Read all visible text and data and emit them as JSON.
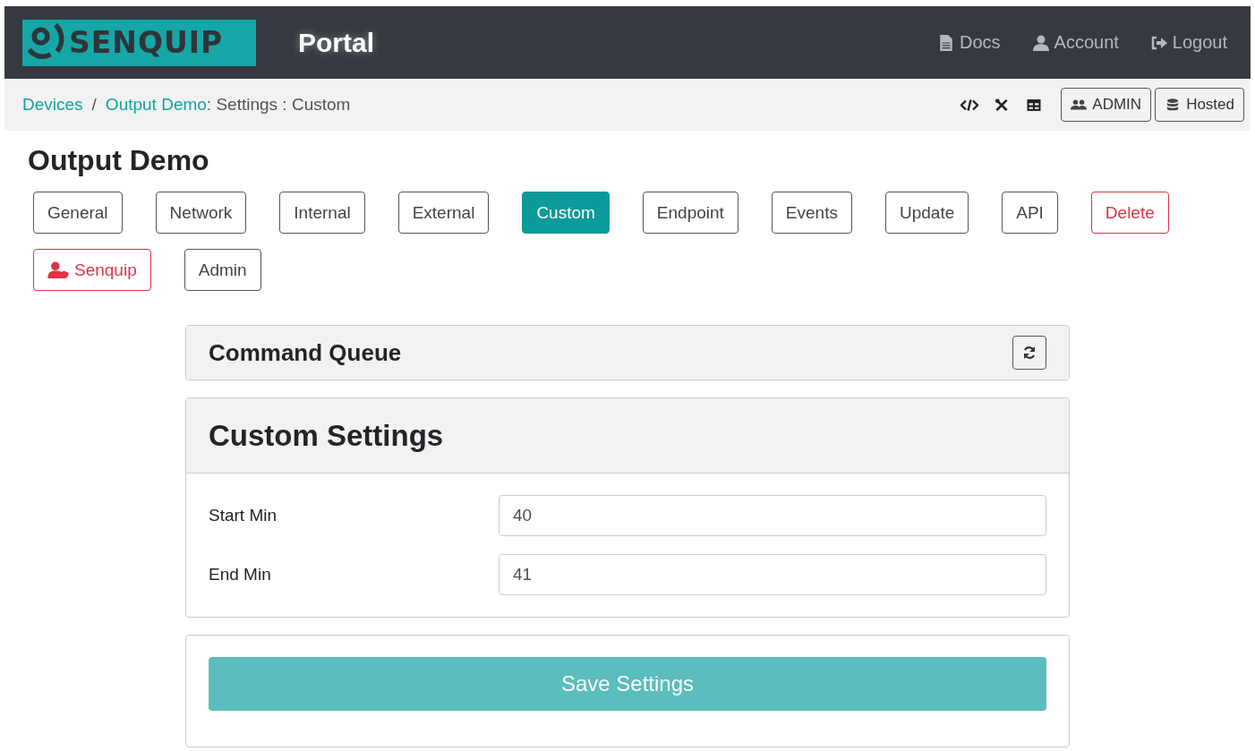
{
  "header": {
    "logo": "SENQUIP",
    "title": "Portal",
    "links": [
      {
        "label": "Docs",
        "kind": "docs"
      },
      {
        "label": "Account",
        "kind": "account"
      },
      {
        "label": "Logout",
        "kind": "logout"
      }
    ]
  },
  "breadcrumb": {
    "links": [
      "Devices",
      "Output Demo"
    ],
    "separator": "/",
    "rest": ": Settings : Custom"
  },
  "toolbar": {
    "buttons": [
      {
        "label": "ADMIN",
        "kind": "admin"
      },
      {
        "label": "Hosted",
        "kind": "hosted"
      }
    ]
  },
  "page_title": "Output Demo",
  "tabs": [
    {
      "label": "General",
      "selected": false,
      "kind": "plain"
    },
    {
      "label": "Network",
      "selected": false,
      "kind": "plain"
    },
    {
      "label": "Internal",
      "selected": false,
      "kind": "plain"
    },
    {
      "label": "External",
      "selected": false,
      "kind": "plain"
    },
    {
      "label": "Custom",
      "selected": true,
      "kind": "plain"
    },
    {
      "label": "Endpoint",
      "selected": false,
      "kind": "plain"
    },
    {
      "label": "Events",
      "selected": false,
      "kind": "plain"
    },
    {
      "label": "Update",
      "selected": false,
      "kind": "plain"
    },
    {
      "label": "API",
      "selected": false,
      "kind": "plain"
    },
    {
      "label": "Delete",
      "selected": false,
      "kind": "danger"
    },
    {
      "label": "Senquip",
      "selected": false,
      "kind": "danger-user"
    },
    {
      "label": "Admin",
      "selected": false,
      "kind": "plain"
    }
  ],
  "command_queue": {
    "title": "Command Queue"
  },
  "custom_settings": {
    "title": "Custom Settings",
    "fields": [
      {
        "label": "Start Min",
        "value": "40"
      },
      {
        "label": "End Min",
        "value": "41"
      }
    ]
  },
  "save_button": {
    "label": "Save Settings"
  }
}
